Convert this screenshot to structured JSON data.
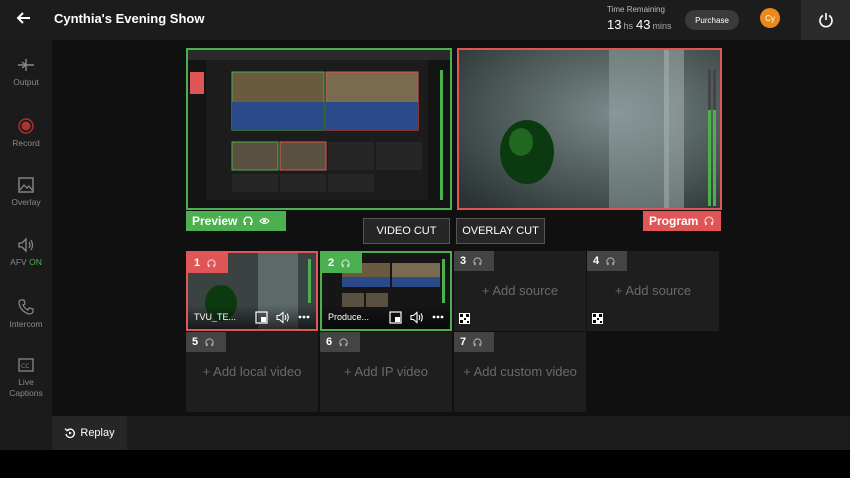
{
  "header": {
    "title": "Cynthia's Evening Show",
    "time_remaining_label": "Time Remaining",
    "hours": "13",
    "hours_unit": "hs",
    "minutes": "43",
    "minutes_unit": "mins",
    "purchase_label": "Purchase",
    "avatar_initials": "Cy"
  },
  "sidebar": {
    "items": [
      {
        "label": "Output",
        "icon": "output-icon"
      },
      {
        "label": "Record",
        "icon": "record-icon"
      },
      {
        "label": "Overlay",
        "icon": "overlay-icon"
      },
      {
        "label": "AFV",
        "status": "ON",
        "icon": "speaker-icon"
      },
      {
        "label": "Intercom",
        "icon": "phone-icon"
      },
      {
        "label": "Live",
        "label2": "Captions",
        "icon": "captions-icon"
      }
    ]
  },
  "monitors": {
    "preview_label": "Preview",
    "program_label": "Program"
  },
  "cuts": {
    "video_cut": "VIDEO CUT",
    "overlay_cut": "OVERLAY CUT"
  },
  "sources": [
    {
      "num": "1",
      "name": "TVU_TE...",
      "state": "program"
    },
    {
      "num": "2",
      "name": "Produce...",
      "state": "preview"
    },
    {
      "num": "3",
      "add": "+ Add source"
    },
    {
      "num": "4",
      "add": "+ Add source"
    },
    {
      "num": "5",
      "add": "+ Add local video"
    },
    {
      "num": "6",
      "add": "+ Add IP video"
    },
    {
      "num": "7",
      "add": "+ Add custom video"
    }
  ],
  "footer": {
    "replay_label": "Replay"
  },
  "colors": {
    "preview": "#4caf50",
    "program": "#e05555",
    "avatar": "#e8891c"
  }
}
